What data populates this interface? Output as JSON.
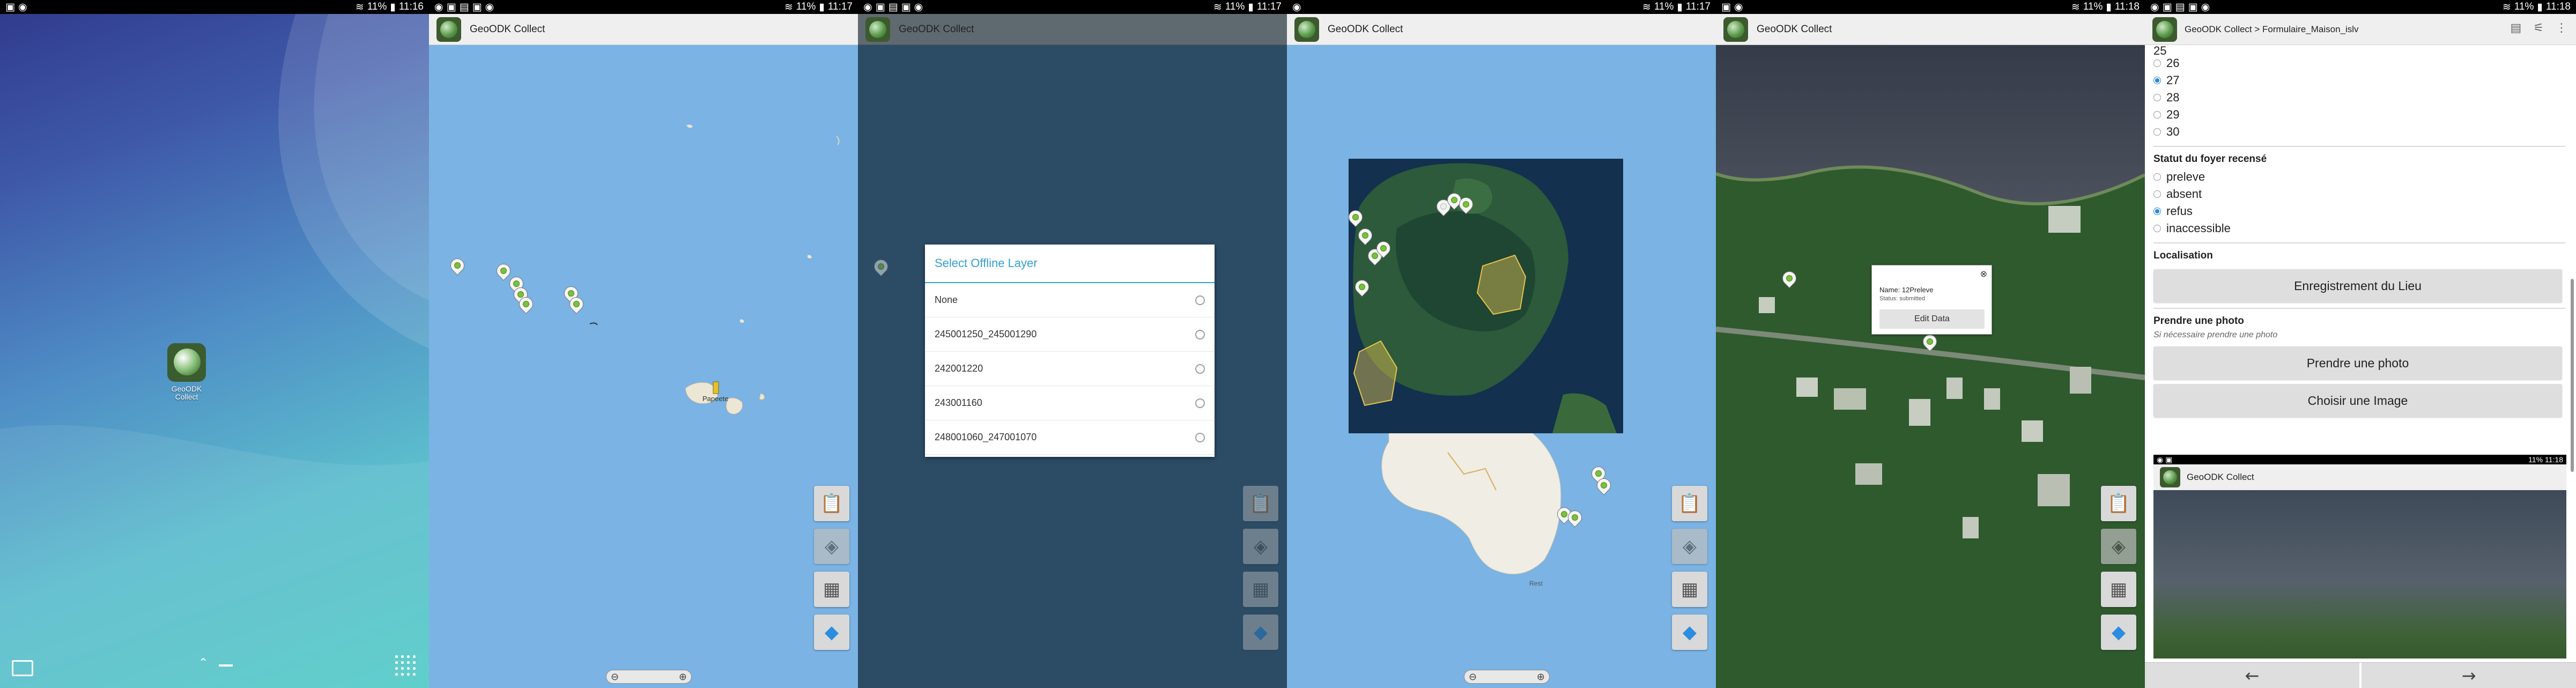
{
  "status": {
    "p1_time": "11:16",
    "p2_time": "11:17",
    "p3_time": "11:17",
    "p4_time": "11:17",
    "p5_time": "11:18",
    "p6_time": "11:18",
    "battery": "11%"
  },
  "home": {
    "app_label": "GeoODK Collect"
  },
  "map": {
    "app_title": "GeoODK Collect",
    "place_label": "Papeete",
    "zoom_out": "⊖",
    "zoom_in": "⊕",
    "fab_icons": [
      "clipboard-icon",
      "layers-icon",
      "grid-icon",
      "locate-icon"
    ]
  },
  "dialog": {
    "title": "Select Offline Layer",
    "options": [
      "None",
      "245001250_245001290",
      "242001220",
      "243001160",
      "248001060_247001070"
    ]
  },
  "popup": {
    "name": "Name: 12Preleve",
    "status": "Status: submitted",
    "button": "Edit Data"
  },
  "form": {
    "breadcrumb": "GeoODK Collect > Formulaire_Maison_islv",
    "numbers": [
      "26",
      "27",
      "28",
      "29",
      "30"
    ],
    "selected_number": "27",
    "statut_label": "Statut du foyer recensé",
    "statut_options": [
      "preleve",
      "absent",
      "refus",
      "inaccessible"
    ],
    "selected_statut": "refus",
    "localisation_label": "Localisation",
    "localisation_button": "Enregistrement du Lieu",
    "photo_label": "Prendre une photo",
    "photo_hint": "Si nécessaire prendre une photo",
    "photo_button": "Prendre une photo",
    "image_button": "Choisir une Image",
    "thumb_time": "11:18",
    "thumb_title": "GeoODK Collect",
    "nav_back": "←",
    "nav_forward": "→"
  },
  "colors": {
    "ocean": "#79b1e3",
    "dialog_accent": "#33a0d8",
    "pin_green": "#7cc03a",
    "radio_selected": "#2a8bd6"
  }
}
